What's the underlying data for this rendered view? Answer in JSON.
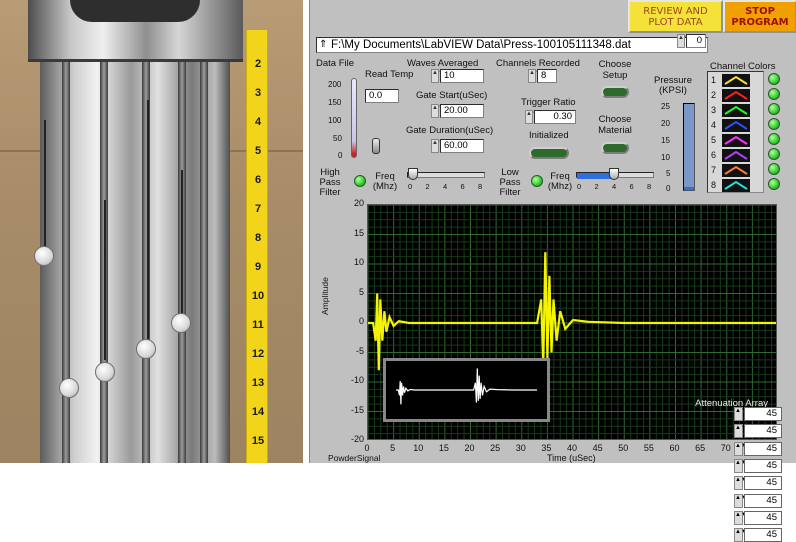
{
  "buttons": {
    "review": "REVIEW AND PLOT DATA",
    "stop": "STOP PROGRAM"
  },
  "path": "F:\\My Documents\\LabVIEW Data\\Press-100105111348.dat",
  "path_icon": "path-symbol-icon",
  "data_file": {
    "label": "Data File",
    "read_temp_label": "Read Temp",
    "read_temp_value": "0.0",
    "scale": [
      "200",
      "150",
      "100",
      "50",
      "0"
    ]
  },
  "waves_averaged": {
    "label": "Waves Averaged",
    "value": "10"
  },
  "gate_start": {
    "label": "Gate Start(uSec)",
    "value": "20.00"
  },
  "gate_duration": {
    "label": "Gate Duration(uSec)",
    "value": "60.00"
  },
  "channels_recorded": {
    "label": "Channels Recorded",
    "value": "8"
  },
  "trigger_ratio": {
    "label": "Trigger Ratio",
    "value": "0.30"
  },
  "initialized": {
    "label": "Initialized"
  },
  "choose_setup": {
    "label": "Choose Setup"
  },
  "choose_material": {
    "label": "Choose Material"
  },
  "pressure": {
    "label": "Pressure (KPSI)",
    "value": "0",
    "scale": [
      "25",
      "20",
      "15",
      "10",
      "5",
      "0"
    ],
    "level": 0.0
  },
  "channel_colors": {
    "title": "Channel Colors",
    "channels": [
      {
        "num": "1",
        "color": "#f4e23a"
      },
      {
        "num": "2",
        "color": "#ff2020"
      },
      {
        "num": "3",
        "color": "#20ff20"
      },
      {
        "num": "4",
        "color": "#3050ff"
      },
      {
        "num": "5",
        "color": "#ff30ff"
      },
      {
        "num": "6",
        "color": "#b040ff"
      },
      {
        "num": "7",
        "color": "#ff7a3a"
      },
      {
        "num": "8",
        "color": "#20e0e0"
      }
    ]
  },
  "high_pass": {
    "label": "High Pass Filter",
    "freq_label": "Freq (Mhz)",
    "scale": [
      "0",
      "2",
      "4",
      "6",
      "8"
    ],
    "value_mhz": 0
  },
  "low_pass": {
    "label": "Low Pass Filter",
    "freq_label": "Freq (Mhz)",
    "scale": [
      "0",
      "2",
      "4",
      "6",
      "8"
    ],
    "value_mhz": 3.6
  },
  "graph": {
    "plot_name": "PowderSignal",
    "xlabel": "Time (uSec)",
    "ylabel": "Amplitude",
    "yticks": [
      "20",
      "15",
      "10",
      "5",
      "0",
      "-5",
      "-10",
      "-15",
      "-20"
    ],
    "xticks": [
      "0",
      "5",
      "10",
      "15",
      "20",
      "25",
      "30",
      "35",
      "40",
      "45",
      "50",
      "55",
      "60",
      "65",
      "70",
      "75",
      "80"
    ],
    "attenuation_title": "Attenuation Array",
    "attenuation_values": [
      "45",
      "45",
      "45",
      "45",
      "45",
      "45",
      "45",
      "45"
    ]
  },
  "chart_data": {
    "type": "line",
    "xlabel": "Time (uSec)",
    "ylabel": "Amplitude",
    "xlim": [
      0,
      80
    ],
    "ylim": [
      -20,
      20
    ],
    "grid": true,
    "series": [
      {
        "color": "#f4f400",
        "x": [
          0,
          1,
          1.5,
          1.8,
          2.1,
          2.4,
          2.8,
          3.2,
          3.6,
          4.2,
          5,
          6,
          8,
          10,
          20,
          30,
          33,
          33.8,
          34.2,
          34.6,
          35,
          35.4,
          35.8,
          36.2,
          36.8,
          37.5,
          38.5,
          40,
          43,
          50,
          60,
          70,
          80
        ],
        "y": [
          0,
          0,
          -3,
          5,
          -8,
          4,
          -3,
          2,
          -1.5,
          1,
          -0.5,
          0.3,
          0,
          0,
          0,
          0,
          0,
          4,
          -7,
          12,
          -6,
          8,
          -5,
          4,
          -3,
          2,
          -1,
          0.5,
          0.2,
          0,
          0,
          0,
          0
        ]
      }
    ]
  },
  "photo": {
    "tape_numbers": [
      "2",
      "3",
      "4",
      "5",
      "6",
      "7",
      "8",
      "9",
      "10",
      "11",
      "12",
      "13",
      "14",
      "15"
    ]
  }
}
